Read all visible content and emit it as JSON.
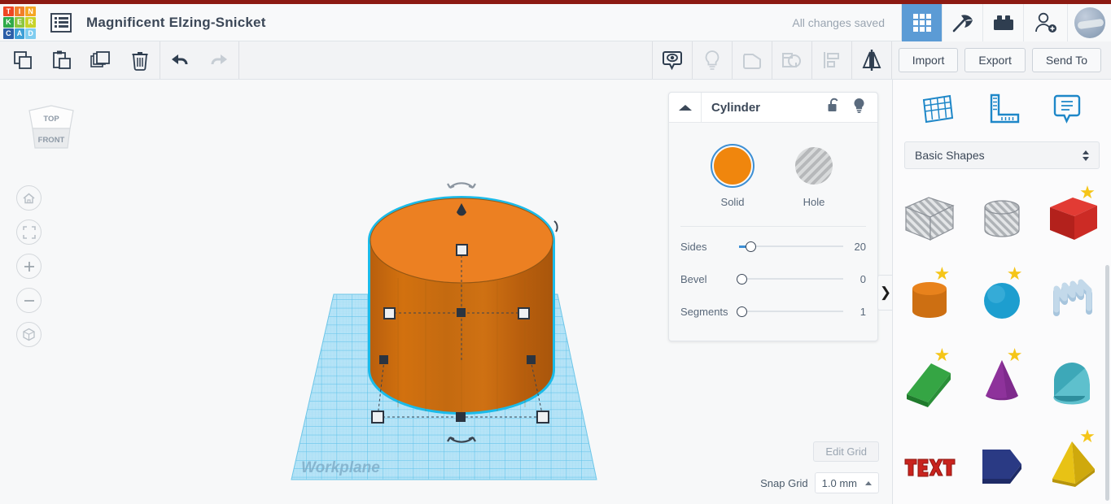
{
  "app": {
    "logo_letters": [
      "T",
      "I",
      "N",
      "K",
      "E",
      "R",
      "C",
      "A",
      "D"
    ],
    "logo_colors": [
      "#ef4623",
      "#f07f2a",
      "#f5a623",
      "#2faa4a",
      "#8dc63f",
      "#c8d32a",
      "#2c5fa8",
      "#3d9fd6",
      "#7fcdf0"
    ],
    "menu_icon": "list-menu-icon",
    "document_title": "Magnificent Elzing-Snicket",
    "save_status": "All changes saved"
  },
  "header_icons": [
    {
      "name": "design-grid-icon",
      "label": "3D Designs",
      "active": true
    },
    {
      "name": "pickaxe-icon",
      "label": "Blocks",
      "active": false
    },
    {
      "name": "brick-icon",
      "label": "Bricks",
      "active": false
    },
    {
      "name": "add-person-icon",
      "label": "Invite",
      "active": false
    },
    {
      "name": "avatar",
      "label": "Account",
      "active": false
    }
  ],
  "toolbar": {
    "left_tools": [
      {
        "name": "copy-icon",
        "label": "Copy",
        "enabled": true
      },
      {
        "name": "paste-icon",
        "label": "Paste",
        "enabled": true
      },
      {
        "name": "duplicate-icon",
        "label": "Duplicate",
        "enabled": true
      },
      {
        "name": "delete-icon",
        "label": "Delete",
        "enabled": true
      }
    ],
    "history_tools": [
      {
        "name": "undo-icon",
        "label": "Undo",
        "enabled": true
      },
      {
        "name": "redo-icon",
        "label": "Redo",
        "enabled": false
      }
    ],
    "right_tools": [
      {
        "name": "note-eye-icon",
        "label": "Show All",
        "enabled": true
      },
      {
        "name": "lightbulb-icon",
        "label": "Hide",
        "enabled": false
      },
      {
        "name": "group-icon",
        "label": "Group",
        "enabled": false
      },
      {
        "name": "ungroup-icon",
        "label": "Ungroup",
        "enabled": false
      },
      {
        "name": "align-icon",
        "label": "Align",
        "enabled": false
      },
      {
        "name": "mirror-icon",
        "label": "Mirror",
        "enabled": true
      }
    ],
    "import_label": "Import",
    "export_label": "Export",
    "send_to_label": "Send To"
  },
  "viewport": {
    "viewcube_top": "TOP",
    "viewcube_front": "FRONT",
    "workplane_label": "Workplane",
    "nav_buttons": [
      {
        "name": "home-view-button",
        "label": "Home view"
      },
      {
        "name": "fit-to-view-button",
        "label": "Fit all in view"
      },
      {
        "name": "zoom-in-button",
        "label": "Zoom in"
      },
      {
        "name": "zoom-out-button",
        "label": "Zoom out"
      },
      {
        "name": "orthographic-toggle-button",
        "label": "Switch to orthographic"
      }
    ],
    "object": {
      "type": "cylinder",
      "color": "#e8801a",
      "selected": true,
      "highlight_color": "#1bbbe9"
    },
    "edit_grid_label": "Edit Grid",
    "snap_grid_label": "Snap Grid",
    "snap_grid_value": "1.0 mm"
  },
  "inspector": {
    "title": "Cylinder",
    "collapse_icon": "triangle-up-icon",
    "lock_icon": "unlock-icon",
    "visibility_icon": "lightbulb-icon",
    "fill_options": [
      {
        "name": "solid",
        "label": "Solid",
        "color": "#f0860d",
        "selected": true
      },
      {
        "name": "hole",
        "label": "Hole",
        "color": "#c6c8ca",
        "selected": false
      }
    ],
    "sliders": [
      {
        "name": "sides",
        "label": "Sides",
        "value": "20",
        "pct": 11
      },
      {
        "name": "bevel",
        "label": "Bevel",
        "value": "0",
        "pct": 0
      },
      {
        "name": "segments",
        "label": "Segments",
        "value": "1",
        "pct": 0
      }
    ]
  },
  "right_panel": {
    "tools": [
      {
        "name": "workplane-icon",
        "label": "Workplane"
      },
      {
        "name": "ruler-icon",
        "label": "Ruler"
      },
      {
        "name": "note-icon",
        "label": "Note"
      }
    ],
    "category_label": "Basic Shapes",
    "collapse_icon": "chevron-right-icon",
    "shapes": [
      {
        "name": "box-hole",
        "label": "Box Hole",
        "starred": false
      },
      {
        "name": "cylinder-hole",
        "label": "Cylinder Hole",
        "starred": false
      },
      {
        "name": "box",
        "label": "Box",
        "starred": true
      },
      {
        "name": "cylinder",
        "label": "Cylinder",
        "starred": true
      },
      {
        "name": "sphere",
        "label": "Sphere",
        "starred": true
      },
      {
        "name": "scribble",
        "label": "Scribble",
        "starred": false
      },
      {
        "name": "wedge",
        "label": "Wedge",
        "starred": true
      },
      {
        "name": "cone",
        "label": "Cone",
        "starred": true
      },
      {
        "name": "roof",
        "label": "Roof",
        "starred": false
      },
      {
        "name": "text",
        "label": "Text",
        "starred": false
      },
      {
        "name": "polygon",
        "label": "Polygon",
        "starred": false
      },
      {
        "name": "pyramid",
        "label": "Pyramid",
        "starred": true
      }
    ]
  }
}
